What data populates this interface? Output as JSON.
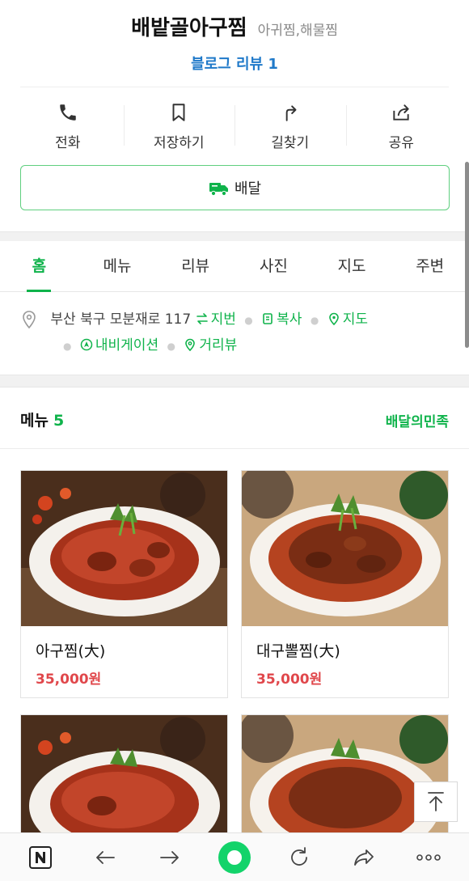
{
  "place": {
    "name": "배밭골아구찜",
    "category": "아귀찜,해물찜",
    "blog_review": "블로그 리뷰 1"
  },
  "actions": [
    {
      "label": "전화",
      "icon": "phone-icon"
    },
    {
      "label": "저장하기",
      "icon": "bookmark-icon"
    },
    {
      "label": "길찾기",
      "icon": "directions-icon"
    },
    {
      "label": "공유",
      "icon": "share-icon"
    }
  ],
  "delivery_button": {
    "label": "배달",
    "icon": "delivery-truck-icon"
  },
  "tabs": [
    {
      "label": "홈",
      "active": true
    },
    {
      "label": "메뉴"
    },
    {
      "label": "리뷰"
    },
    {
      "label": "사진"
    },
    {
      "label": "지도"
    },
    {
      "label": "주변"
    }
  ],
  "address": {
    "text": "부산 북구 모분재로 117",
    "links": {
      "jibun": "지번",
      "copy": "복사",
      "map": "지도",
      "navigation": "내비게이션",
      "street_view": "거리뷰"
    }
  },
  "menu": {
    "title": "메뉴",
    "count": "5",
    "link": "배달의민족",
    "items": [
      {
        "name": "아구찜(大)",
        "price": "35,000원"
      },
      {
        "name": "대구뽈찜(大)",
        "price": "35,000원"
      },
      {
        "name": "",
        "price": ""
      },
      {
        "name": "",
        "price": ""
      }
    ]
  },
  "colors": {
    "accent_green": "#0fb34b",
    "link_blue": "#1f79c9",
    "price_red": "#e0474b"
  }
}
